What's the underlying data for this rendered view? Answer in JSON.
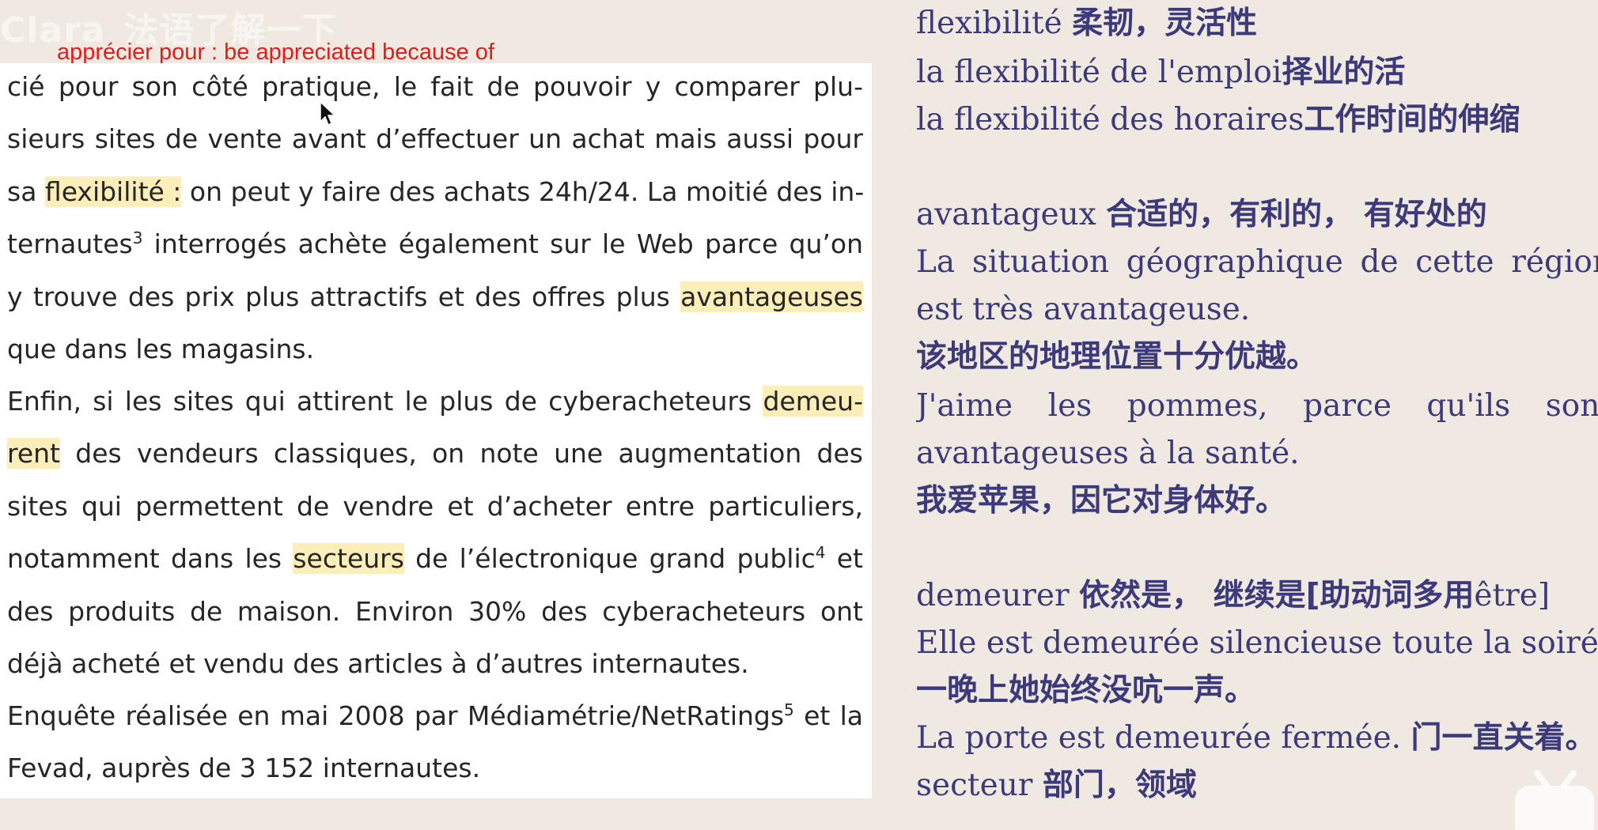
{
  "watermark": "Clara_法语了解一下",
  "annotation": "apprécier pour : be appreciated because of",
  "textbook": {
    "lines": [
      {
        "type": "plain",
        "text": "cié pour son côté pratique, le fait de pouvoir y comparer plu-"
      },
      {
        "type": "plain",
        "text": "sieurs sites de vente avant d’effectuer un achat mais aussi pour"
      },
      {
        "type": "hl_mid",
        "before": "sa ",
        "hl": "flexibilité :",
        "after": " on peut y faire des achats 24h/24. La moitié des in-"
      },
      {
        "type": "sup",
        "before": "ternautes",
        "sup": "3",
        "after": " interrogés achète également sur le Web parce qu’on"
      },
      {
        "type": "hl_end",
        "before": "y trouve des prix plus attractifs et des offres plus ",
        "hl": "avantageuses"
      },
      {
        "type": "plain_left",
        "text": "que dans les magasins."
      },
      {
        "type": "hl_end",
        "before": "Enfin, si les sites qui attirent le plus de cyberacheteurs ",
        "hl": "demeu-"
      },
      {
        "type": "hl_start",
        "hl": "rent",
        "after": " des vendeurs classiques, on note une augmentation des"
      },
      {
        "type": "plain",
        "text": "sites qui permettent de vendre et d’acheter entre particuliers,"
      },
      {
        "type": "hl_sup",
        "before": "notamment dans les ",
        "hl": "secteurs",
        "mid": " de l’électronique grand public",
        "sup": "4",
        "after": " et"
      },
      {
        "type": "plain",
        "text": "des produits de maison. Environ 30% des cyberacheteurs ont"
      },
      {
        "type": "plain_left",
        "text": "déjà acheté et vendu des articles à d’autres internautes."
      },
      {
        "type": "sup",
        "before": "Enquête réalisée en mai 2008 par Médiamétrie/NetRatings",
        "sup": "5",
        "after": " et la"
      },
      {
        "type": "plain_left",
        "text": "Fevad, auprès de 3 152 internautes."
      }
    ]
  },
  "notes": [
    {
      "fr": "flexibilité ",
      "zh": "柔韧，灵活性"
    },
    {
      "fr": "la flexibilité de l'emploi",
      "zh": "择业的活"
    },
    {
      "fr": "la flexibilité des horaires",
      "zh": "工作时间的伸缩"
    },
    {
      "fr": "avantageux ",
      "zh": "合适的，有利的， 有好处的"
    },
    {
      "fr": "La situation géographique de cette région",
      "zh": "",
      "justify": true
    },
    {
      "fr": "est très avantageuse.",
      "zh": ""
    },
    {
      "fr": "",
      "zh": "该地区的地理位置十分优越。"
    },
    {
      "fr": "J'aime les pommes, parce qu'ils sont",
      "zh": "",
      "justify": true
    },
    {
      "fr": "avantageuses à la santé.",
      "zh": ""
    },
    {
      "fr": "",
      "zh": "我爱苹果，因它对身体好。"
    },
    {
      "fr": "demeurer ",
      "zh": "依然是， 继续是[助动词多用",
      "fr2": "être]"
    },
    {
      "fr": "Elle est demeurée silencieuse toute la soirée.",
      "zh": ""
    },
    {
      "fr": "",
      "zh": "一晚上她始终没吭一声。"
    },
    {
      "fr": "La porte est demeurée fermée. ",
      "zh": "门一直关着。"
    },
    {
      "fr": "secteur ",
      "zh": "部门，领域"
    }
  ]
}
